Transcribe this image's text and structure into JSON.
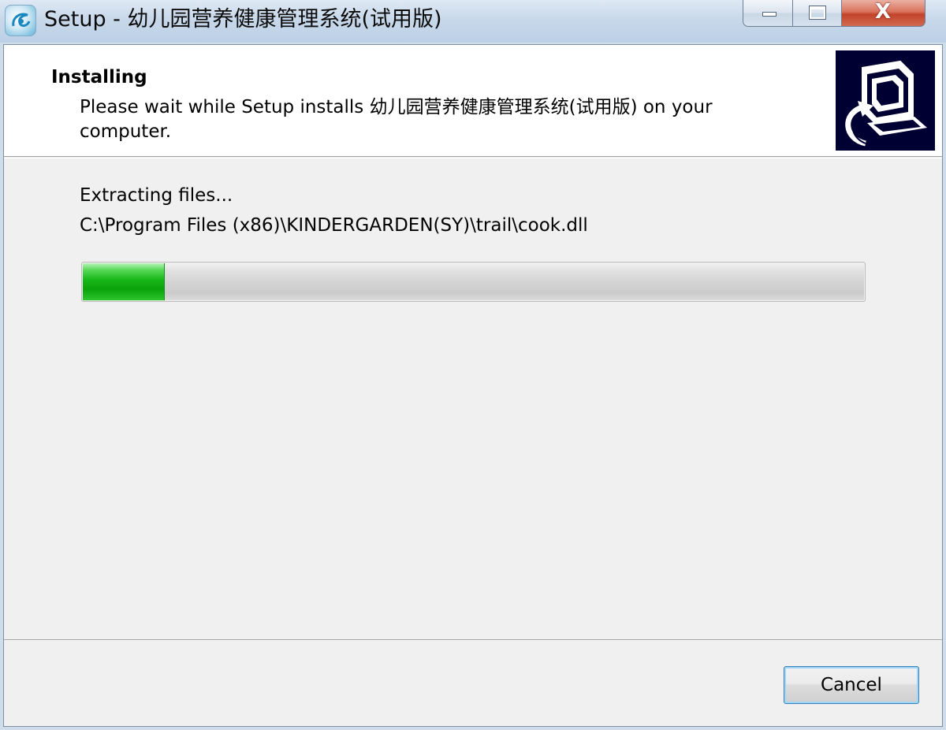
{
  "window": {
    "title": "Setup - 幼儿园营养健康管理系统(试用版)",
    "icon": "setup-app-icon",
    "caption_buttons": {
      "minimize_icon": "minimize-icon",
      "maximize_icon": "maximize-icon",
      "close_glyph": "X"
    }
  },
  "header": {
    "heading": "Installing",
    "subheading": "Please wait while Setup installs 幼儿园营养健康管理系统(试用版) on your computer.",
    "image_icon": "installer-computer-icon"
  },
  "progress": {
    "status": "Extracting files...",
    "current_file": "C:\\Program Files (x86)\\KINDERGARDEN(SY)\\trail\\cook.dll",
    "fraction": 0.105,
    "color": "#17b617"
  },
  "footer": {
    "cancel_label": "Cancel"
  },
  "colors": {
    "title_bar": "#c8d8ea",
    "close_button": "#c2432a",
    "header_background": "#ffffff",
    "body_background": "#f0f0f0",
    "wizard_image_background": "#000033"
  }
}
